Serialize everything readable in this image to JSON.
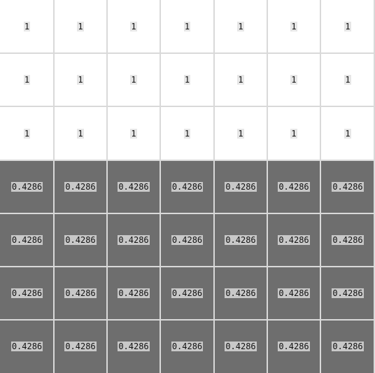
{
  "grid": {
    "rows": [
      [
        "1",
        "1",
        "1",
        "1",
        "1",
        "1",
        "1"
      ],
      [
        "1",
        "1",
        "1",
        "1",
        "1",
        "1",
        "1"
      ],
      [
        "1",
        "1",
        "1",
        "1",
        "1",
        "1",
        "1"
      ],
      [
        "0.4286",
        "0.4286",
        "0.4286",
        "0.4286",
        "0.4286",
        "0.4286",
        "0.4286"
      ],
      [
        "0.4286",
        "0.4286",
        "0.4286",
        "0.4286",
        "0.4286",
        "0.4286",
        "0.4286"
      ],
      [
        "0.4286",
        "0.4286",
        "0.4286",
        "0.4286",
        "0.4286",
        "0.4286",
        "0.4286"
      ],
      [
        "0.4286",
        "0.4286",
        "0.4286",
        "0.4286",
        "0.4286",
        "0.4286",
        "0.4286"
      ]
    ],
    "row_tone": [
      "light",
      "light",
      "light",
      "dark",
      "dark",
      "dark",
      "dark"
    ],
    "colors": {
      "light_cell": "#ffffff",
      "dark_cell": "#6e6e6e",
      "grid_line": "#d9d9d9",
      "light_label_bg": "#e6e6e6",
      "dark_label_bg": "#c8c8c8"
    }
  }
}
